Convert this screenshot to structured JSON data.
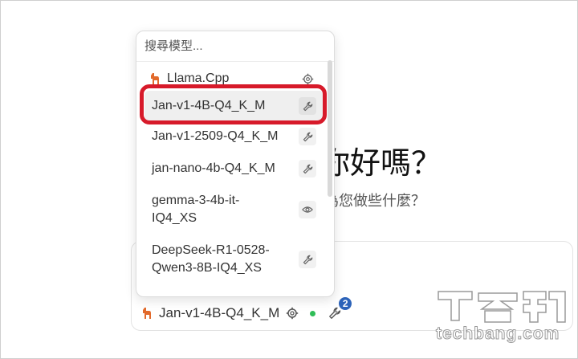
{
  "chat": {
    "greeting": "你好嗎？",
    "subgreeting": "為您做些什麼？"
  },
  "dropdown": {
    "search_placeholder": "搜尋模型...",
    "provider": {
      "name": "Llama.Cpp",
      "icon": "llama-icon",
      "trailing_icon": "gear-icon"
    },
    "models": [
      {
        "name": "Jan-v1-4B-Q4_K_M",
        "icon": "wrench-icon",
        "selected": true
      },
      {
        "name": "Jan-v1-2509-Q4_K_M",
        "icon": "wrench-icon",
        "selected": false
      },
      {
        "name": "jan-nano-4b-Q4_K_M",
        "icon": "wrench-icon",
        "selected": false
      },
      {
        "name": "gemma-3-4b-it-\nIQ4_XS",
        "icon": "eye-icon",
        "selected": false
      },
      {
        "name": "DeepSeek-R1-0528-\nQwen3-8B-IQ4_XS",
        "icon": "wrench-icon",
        "selected": false
      }
    ]
  },
  "composer": {
    "model_name": "Jan-v1-4B-Q4_K_M",
    "tools_badge": "2",
    "status": "green"
  },
  "watermark": {
    "logo_text": "T客邦",
    "url": "techbang.com"
  },
  "colors": {
    "highlight": "#d71a2a",
    "badge": "#2c63b9",
    "status_dot": "#2fbd57",
    "llama_accent": "#e26a2c"
  }
}
